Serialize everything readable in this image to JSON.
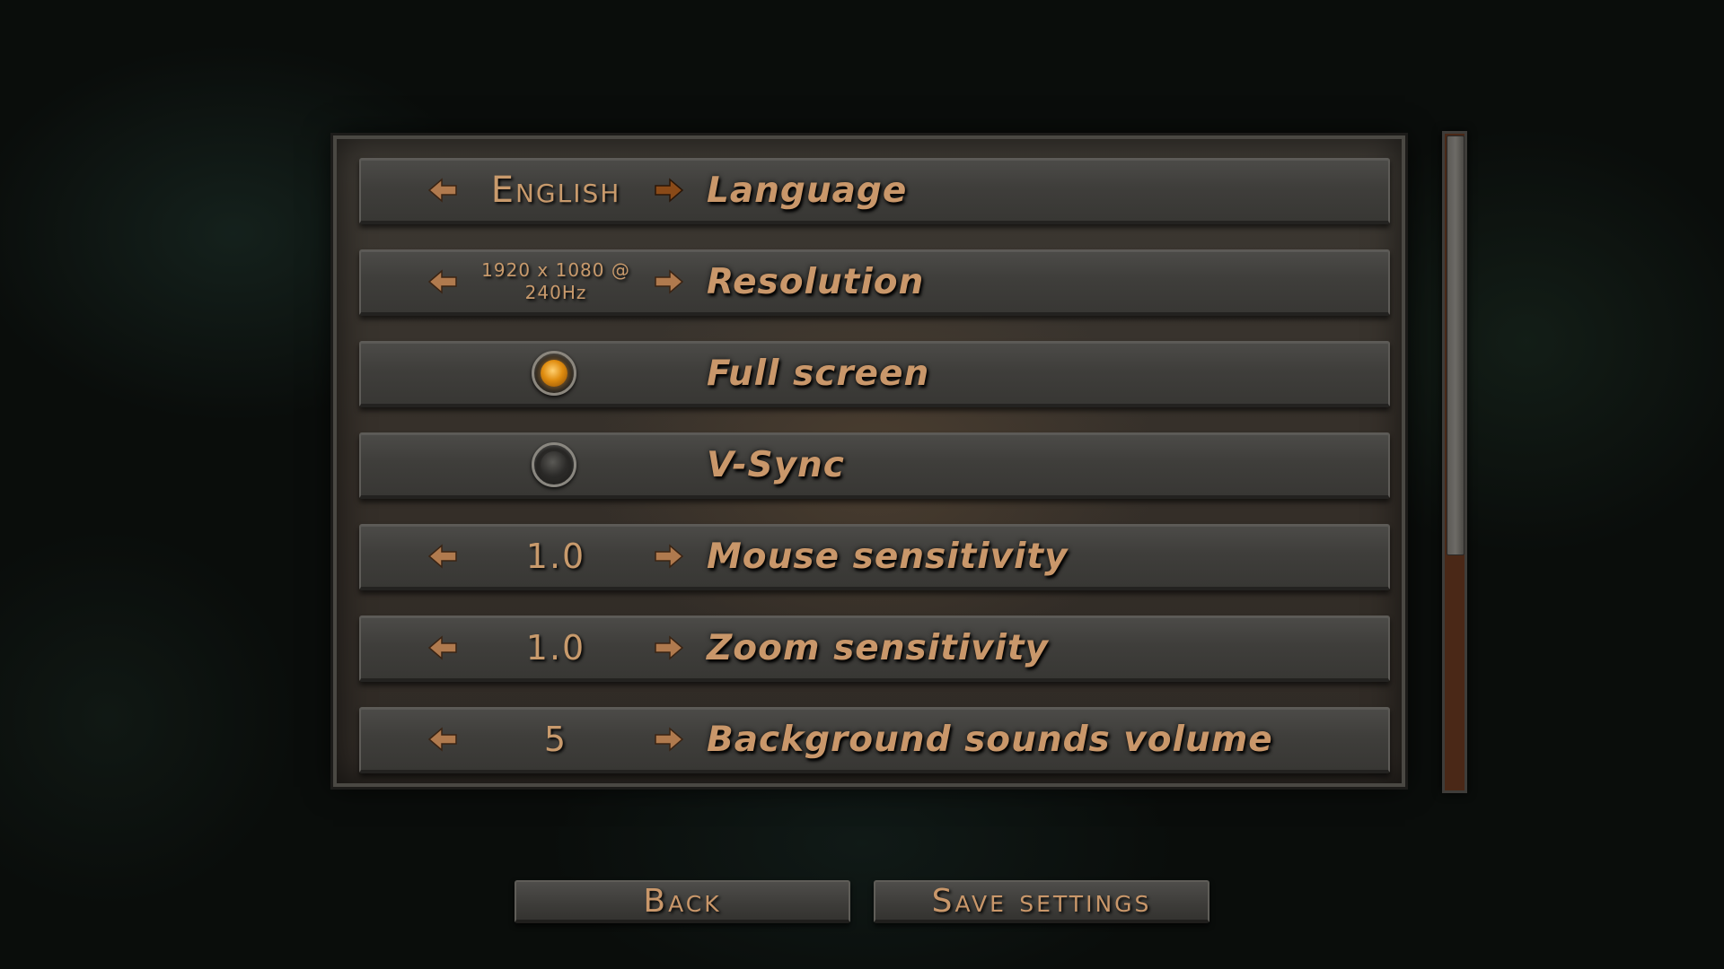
{
  "settings": {
    "language": {
      "label": "Language",
      "value": "English"
    },
    "resolution": {
      "label": "Resolution",
      "value": "1920 x 1080 @\n240Hz"
    },
    "fullscreen": {
      "label": "Full screen",
      "enabled": true
    },
    "vsync": {
      "label": "V-Sync",
      "enabled": false
    },
    "mouse_sensitivity": {
      "label": "Mouse sensitivity",
      "value": "1.0"
    },
    "zoom_sensitivity": {
      "label": "Zoom sensitivity",
      "value": "1.0"
    },
    "background_sounds_volume": {
      "label": "Background sounds volume",
      "value": "5"
    }
  },
  "buttons": {
    "back": "Back",
    "save": "Save settings"
  },
  "scroll": {
    "position_fraction": 0.0,
    "visible_fraction": 0.64
  },
  "colors": {
    "text_accent": "#c9976a",
    "arrow_dim": "#b07a4e",
    "arrow_active": "#8a4a18",
    "toggle_on": "#e08d10"
  },
  "icons": {
    "prev": "arrow-left-icon",
    "next": "arrow-right-icon"
  }
}
